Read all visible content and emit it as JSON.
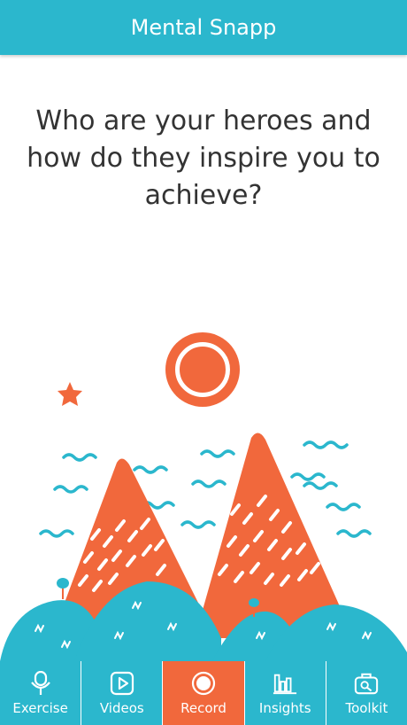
{
  "app_bar": {
    "title": "Mental Snapp"
  },
  "prompt": {
    "text": "Who are your heroes and how do they inspire you to achieve?"
  },
  "tabs": [
    {
      "label": "Exercise",
      "icon": "microphone-icon",
      "active": false
    },
    {
      "label": "Videos",
      "icon": "play-icon",
      "active": false
    },
    {
      "label": "Record",
      "icon": "record-icon",
      "active": true
    },
    {
      "label": "Insights",
      "icon": "bar-chart-icon",
      "active": false
    },
    {
      "label": "Toolkit",
      "icon": "toolkit-icon",
      "active": false
    }
  ],
  "colors": {
    "primary": "#2bb7cd",
    "accent": "#f1683c",
    "text": "#333333",
    "background": "#ffffff"
  }
}
